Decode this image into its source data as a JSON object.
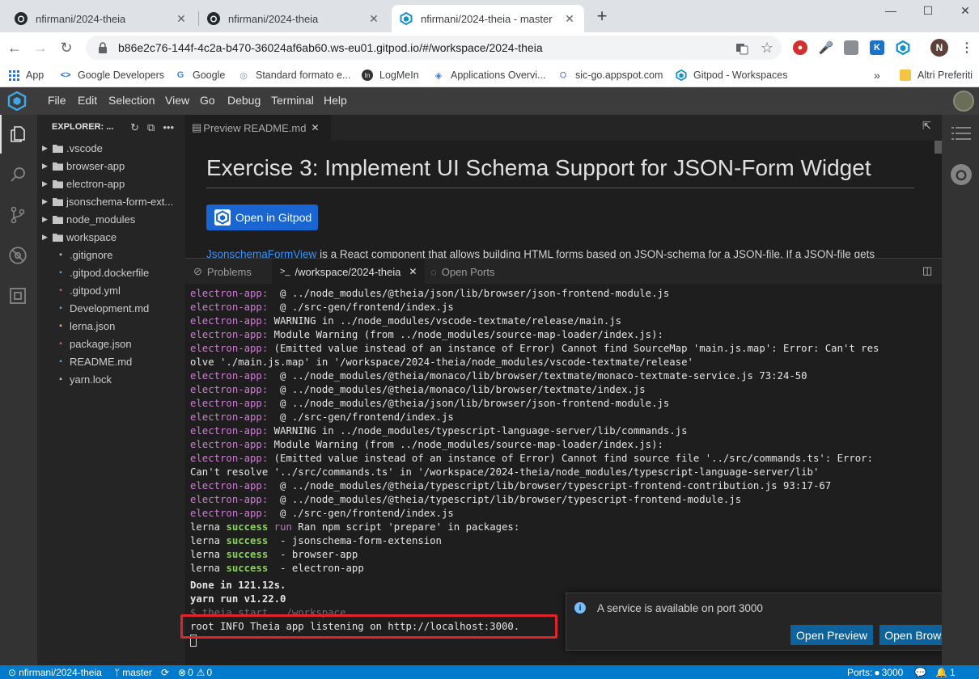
{
  "browser": {
    "tabs": [
      {
        "title": "nfirmani/2024-theia"
      },
      {
        "title": "nfirmani/2024-theia"
      },
      {
        "title": "nfirmani/2024-theia - master"
      }
    ],
    "url": "b86e2c76-144f-4c2a-b470-36024af6ab60.ws-eu01.gitpod.io/#/workspace/2024-theia",
    "profile_initial": "N",
    "bookmarks": [
      "App",
      "Google Developers",
      "Google",
      "Standard formato e...",
      "LogMeIn",
      "Applications Overvi...",
      "sic-go.appspot.com",
      "Gitpod - Workspaces"
    ],
    "other_bookmarks": "Altri Preferiti"
  },
  "menu": [
    "File",
    "Edit",
    "Selection",
    "View",
    "Go",
    "Debug",
    "Terminal",
    "Help"
  ],
  "explorer": {
    "title": "EXPLORER: ...",
    "items": [
      {
        "name": ".vscode",
        "type": "folder"
      },
      {
        "name": "browser-app",
        "type": "folder"
      },
      {
        "name": "electron-app",
        "type": "folder"
      },
      {
        "name": "jsonschema-form-ext...",
        "type": "folder"
      },
      {
        "name": "node_modules",
        "type": "folder"
      },
      {
        "name": "workspace",
        "type": "folder"
      },
      {
        "name": ".gitignore",
        "type": "file"
      },
      {
        "name": ".gitpod.dockerfile",
        "type": "file"
      },
      {
        "name": ".gitpod.yml",
        "type": "file"
      },
      {
        "name": "Development.md",
        "type": "file"
      },
      {
        "name": "lerna.json",
        "type": "file"
      },
      {
        "name": "package.json",
        "type": "file"
      },
      {
        "name": "README.md",
        "type": "file"
      },
      {
        "name": "yarn.lock",
        "type": "file"
      }
    ]
  },
  "editor": {
    "tab_label": "Preview README.md",
    "heading": "Exercise 3: Implement UI Schema Support for JSON-Form Widget",
    "gitpod_button": "Open in Gitpod",
    "para_link": "JsonschemaFormView",
    "para_text": " is a React component that allows building HTML forms based on JSON-schema for a JSON-file. If a JSON-file gets"
  },
  "panel": {
    "tabs": [
      "Problems",
      "/workspace/2024-theia",
      "Open Ports"
    ],
    "terminal_lines": [
      {
        "p": "electron-app:",
        "t": "  @ ../node_modules/@theia/json/lib/browser/json-frontend-module.js"
      },
      {
        "p": "electron-app:",
        "t": "  @ ./src-gen/frontend/index.js"
      },
      {
        "p": "electron-app:",
        "t": " WARNING in ../node_modules/vscode-textmate/release/main.js"
      },
      {
        "p": "electron-app:",
        "t": " Module Warning (from ../node_modules/source-map-loader/index.js):"
      },
      {
        "p": "electron-app:",
        "t": " (Emitted value instead of an instance of Error) Cannot find SourceMap 'main.js.map': Error: Can't res"
      },
      {
        "p": "",
        "t": "olve './main.js.map' in '/workspace/2024-theia/node_modules/vscode-textmate/release'"
      },
      {
        "p": "electron-app:",
        "t": "  @ ../node_modules/@theia/monaco/lib/browser/textmate/monaco-textmate-service.js 73:24-50"
      },
      {
        "p": "electron-app:",
        "t": "  @ ../node_modules/@theia/monaco/lib/browser/textmate/index.js"
      },
      {
        "p": "electron-app:",
        "t": "  @ ../node_modules/@theia/json/lib/browser/json-frontend-module.js"
      },
      {
        "p": "electron-app:",
        "t": "  @ ./src-gen/frontend/index.js"
      },
      {
        "p": "electron-app:",
        "t": " WARNING in ../node_modules/typescript-language-server/lib/commands.js"
      },
      {
        "p": "electron-app:",
        "t": " Module Warning (from ../node_modules/source-map-loader/index.js):"
      },
      {
        "p": "electron-app:",
        "t": " (Emitted value instead of an instance of Error) Cannot find source file '../src/commands.ts': Error:"
      },
      {
        "p": "",
        "t": "Can't resolve '../src/commands.ts' in '/workspace/2024-theia/node_modules/typescript-language-server/lib'"
      },
      {
        "p": "electron-app:",
        "t": "  @ ../node_modules/@theia/typescript/lib/browser/typescript-frontend-contribution.js 93:17-67"
      },
      {
        "p": "electron-app:",
        "t": "  @ ../node_modules/@theia/typescript/lib/browser/typescript-frontend-module.js"
      },
      {
        "p": "electron-app:",
        "t": "  @ ./src-gen/frontend/index.js"
      }
    ],
    "lerna_lines": [
      {
        "lerna": "lerna",
        "status": "success",
        "run": "run",
        "t": " Ran npm script 'prepare' in packages:"
      },
      {
        "lerna": "lerna",
        "status": "success",
        "run": "",
        "t": " - jsonschema-form-extension"
      },
      {
        "lerna": "lerna",
        "status": "success",
        "run": "",
        "t": " - browser-app"
      },
      {
        "lerna": "lerna",
        "status": "success",
        "run": "",
        "t": " - electron-app"
      }
    ],
    "done_line": "Done in 121.12s.",
    "yarn_line": "yarn run v1.22.0",
    "cmd_line": "$ theia start ../workspace",
    "info_line": "root INFO Theia app listening on http://localhost:3000."
  },
  "notification": {
    "message": "A service is available on port 3000",
    "open_preview": "Open Preview",
    "open_browser": "Open Browser"
  },
  "status": {
    "repo": "nfirmani/2024-theia",
    "branch": "master",
    "errors": "0",
    "warnings": "0",
    "ports_label": "Ports:",
    "port": "3000",
    "bell_count": "1"
  }
}
